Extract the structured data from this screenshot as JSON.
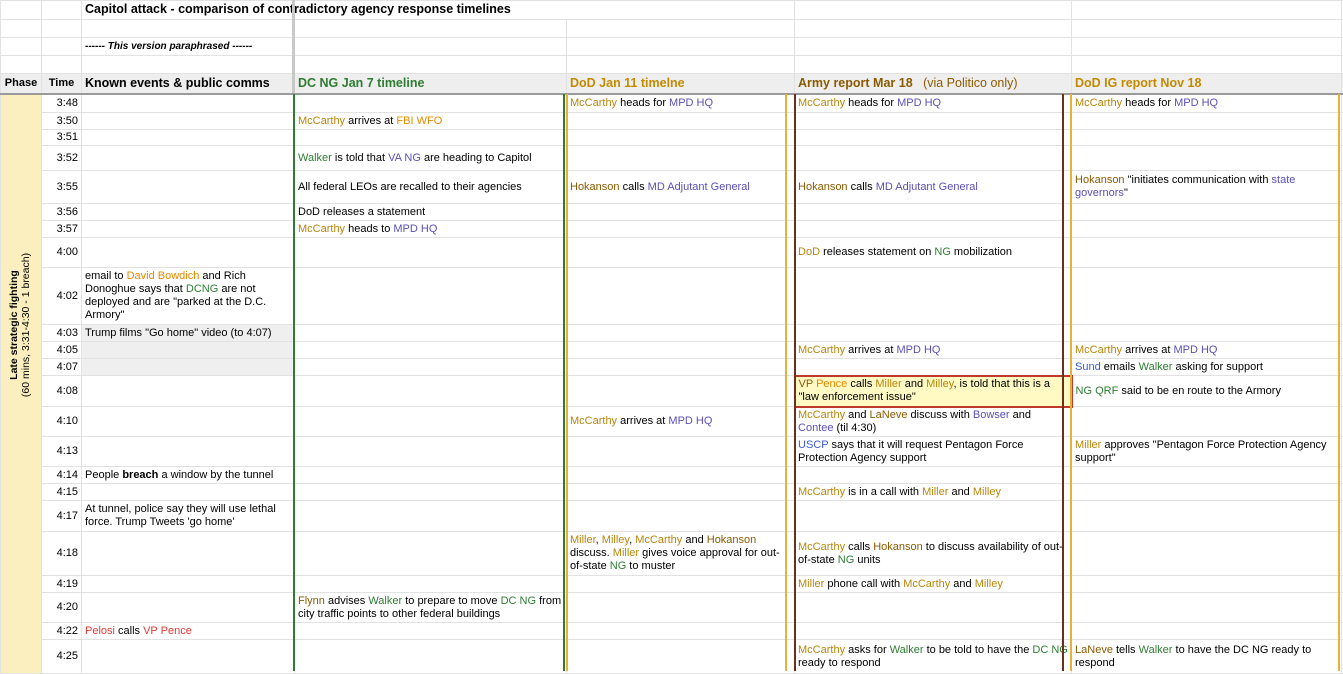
{
  "header": {
    "title": "Capitol attack   -   comparison of contradictory agency response timelines",
    "subtitle": "------ This version paraphrased  ------",
    "cols": {
      "phase": "Phase",
      "time": "Time",
      "known": "Known events & public comms",
      "dcng": "DC NG Jan 7 timeline",
      "dod": "DoD Jan 11 timelne",
      "army": "Army report Mar 18",
      "army_sub": "(via Politico only)",
      "ig": "DoD IG report Nov 18"
    }
  },
  "phase": {
    "line1": "Late strategic fighting",
    "line2": "(60 mins, 3:31-4:30  - 1 breach)"
  },
  "times": [
    "3:48",
    "3:50",
    "3:51",
    "3:52",
    "3:55",
    "3:56",
    "3:57",
    "4:00",
    "4:02",
    "4:03",
    "4:05",
    "4:07",
    "4:08",
    "4:10",
    "4:13",
    "4:14",
    "4:15",
    "4:17",
    "4:18",
    "4:19",
    "4:20",
    "4:22",
    "4:25"
  ],
  "colors": {
    "phase_bg": "#fbefc0",
    "dcng_line": "#2e7d32",
    "dod_line": "#e8b23a",
    "army_line": "#6b2f1a",
    "ig_line": "#e8b23a",
    "highlight_bg": "#fff9c4",
    "highlight_border": "#c0392b"
  }
}
